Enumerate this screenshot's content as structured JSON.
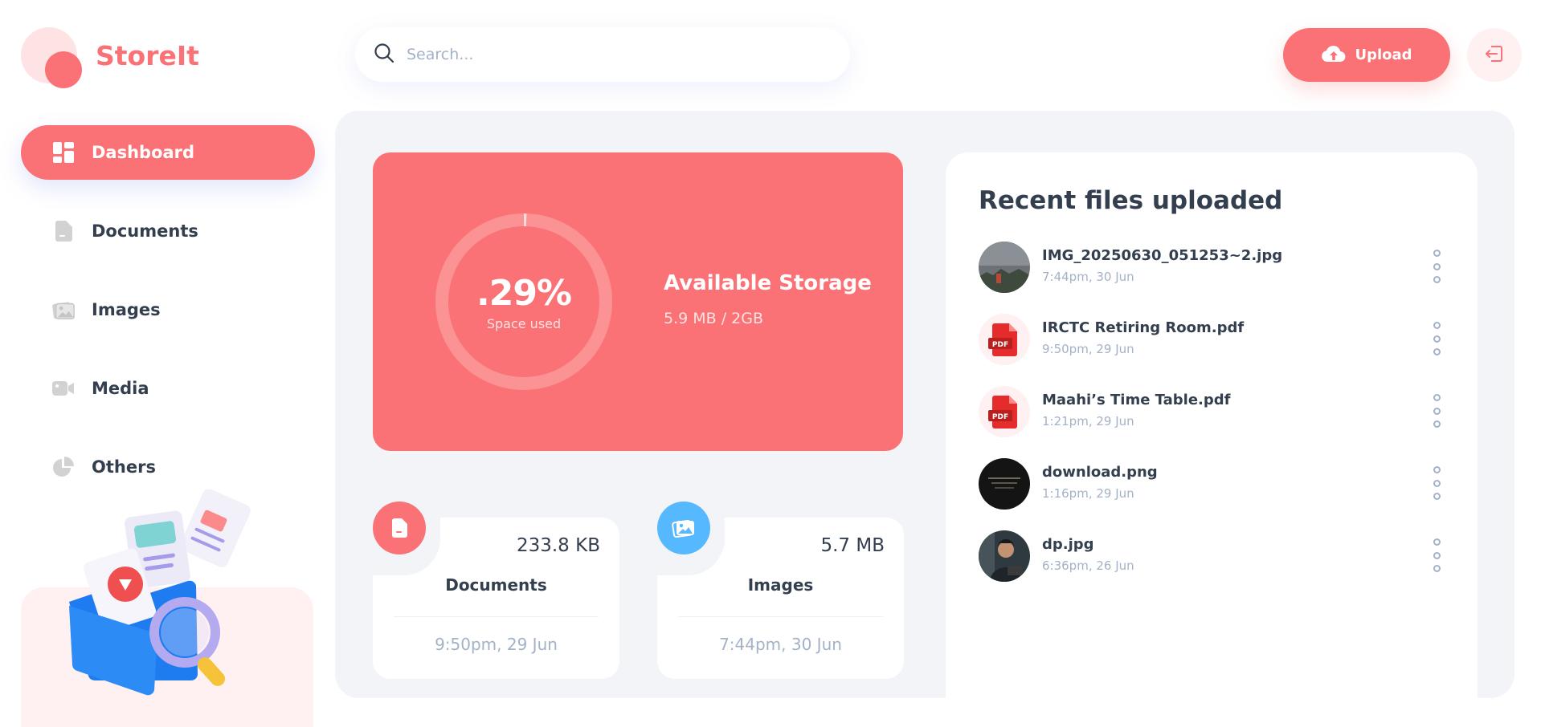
{
  "brand": {
    "name": "StoreIt",
    "accent": "#FA7275"
  },
  "sidebar": {
    "items": [
      {
        "label": "Dashboard",
        "icon": "dashboard-icon",
        "active": true
      },
      {
        "label": "Documents",
        "icon": "document-icon",
        "active": false
      },
      {
        "label": "Images",
        "icon": "image-icon",
        "active": false
      },
      {
        "label": "Media",
        "icon": "video-icon",
        "active": false
      },
      {
        "label": "Others",
        "icon": "pie-chart-icon",
        "active": false
      }
    ]
  },
  "header": {
    "search_placeholder": "Search...",
    "upload_label": "Upload",
    "upload_icon": "cloud-upload-icon",
    "logout_icon": "logout-icon"
  },
  "storage": {
    "percent_label": ".29%",
    "percent_used": 0.29,
    "space_used_label": "Space used",
    "title": "Available Storage",
    "usage": "5.9 MB / 2GB"
  },
  "summaries": [
    {
      "name": "Documents",
      "size": "233.8 KB",
      "date": "9:50pm, 29 Jun",
      "icon": "document-icon",
      "color": "#FA7275"
    },
    {
      "name": "Images",
      "size": "5.7 MB",
      "date": "7:44pm, 30 Jun",
      "icon": "image-icon",
      "color": "#56B8FF"
    }
  ],
  "recent": {
    "title": "Recent files uploaded",
    "files": [
      {
        "name": "IMG_20250630_051253~2.jpg",
        "date": "7:44pm, 30 Jun",
        "type": "image"
      },
      {
        "name": "IRCTC Retiring Room.pdf",
        "date": "9:50pm, 29 Jun",
        "type": "pdf"
      },
      {
        "name": "Maahi’s Time Table.pdf",
        "date": "1:21pm, 29 Jun",
        "type": "pdf"
      },
      {
        "name": "download.png",
        "date": "1:16pm, 29 Jun",
        "type": "image"
      },
      {
        "name": "dp.jpg",
        "date": "6:36pm, 26 Jun",
        "type": "image"
      }
    ],
    "pdf_badge": "PDF"
  }
}
